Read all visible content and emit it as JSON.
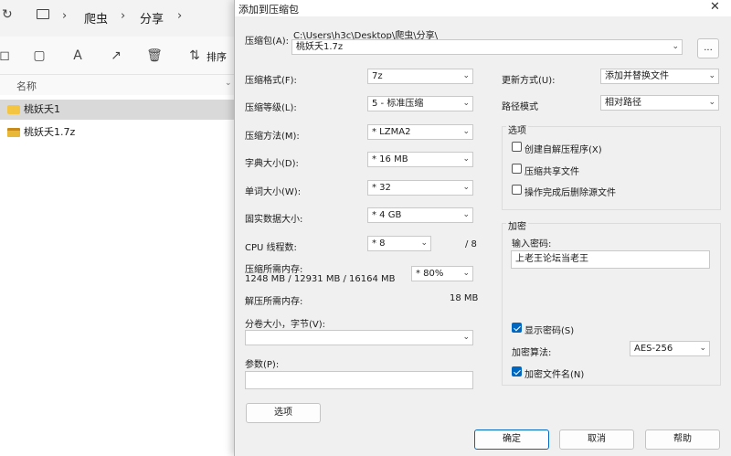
{
  "explorer": {
    "breadcrumb": [
      "爬虫",
      "分享"
    ],
    "toolbar_sort_label": "排序",
    "column_name": "名称",
    "files": [
      {
        "name": "桃妖夭1",
        "type": "folder",
        "selected": true
      },
      {
        "name": "桃妖夭1.7z",
        "type": "archive",
        "selected": false
      }
    ]
  },
  "dialog": {
    "title": "添加到压缩包",
    "archive_label": "压缩包(A):",
    "archive_path": "C:\\Users\\h3c\\Desktop\\爬虫\\分享\\",
    "archive_name": "桃妖夭1.7z",
    "browse_label": "...",
    "format_label": "压缩格式(F):",
    "format_value": "7z",
    "level_label": "压缩等级(L):",
    "level_value": "5 - 标准压缩",
    "method_label": "压缩方法(M):",
    "method_value": "* LZMA2",
    "dict_label": "字典大小(D):",
    "dict_value": "* 16 MB",
    "word_label": "单词大小(W):",
    "word_value": "* 32",
    "solid_label": "固实数据大小:",
    "solid_value": "* 4 GB",
    "cpu_label": "CPU 线程数:",
    "cpu_value": "* 8",
    "cpu_total": "/ 8",
    "mem_label": "压缩所需内存:",
    "mem_detail": "1248 MB / 12931 MB / 16164 MB",
    "mem_value": "* 80%",
    "decomp_label": "解压所需内存:",
    "decomp_value": "18 MB",
    "split_label": "分卷大小，字节(V):",
    "split_value": "",
    "params_label": "参数(P):",
    "params_value": "",
    "options_button": "选项",
    "update_label": "更新方式(U):",
    "update_value": "添加并替换文件",
    "path_label": "路径模式",
    "path_value": "相对路径",
    "options_group": "选项",
    "opt_sfx": "创建自解压程序(X)",
    "opt_shared": "压缩共享文件",
    "opt_delete": "操作完成后删除源文件",
    "encrypt_group": "加密",
    "password_label": "输入密码:",
    "password_value": "上老王论坛当老王",
    "show_password": "显示密码(S)",
    "enc_method_label": "加密算法:",
    "enc_method_value": "AES-256",
    "encrypt_names": "加密文件名(N)",
    "ok": "确定",
    "cancel": "取消",
    "help": "帮助"
  }
}
